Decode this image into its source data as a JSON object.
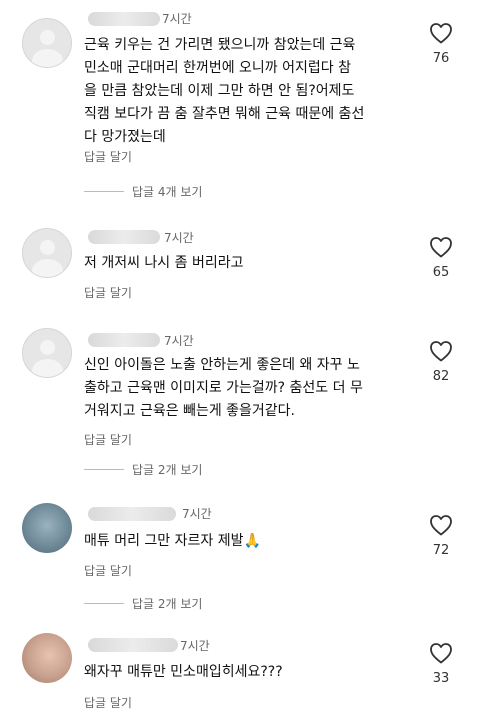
{
  "comments": [
    {
      "time": "7시간",
      "text": "근육 키우는 건 가리면 됐으니까 참았는데 근육\n민소매 군대머리 한꺼번에 오니까 어지럽다 참\n을 만큼 참았는데 이제 그만 하면 안 됨?어제도\n직캠 보다가 끔 춤 잘추면 뭐해 근육 때문에 춤선\n다 망가졌는데",
      "reply_label": "답글 달기",
      "view_replies_label": "답글 4개 보기",
      "likes": "76"
    },
    {
      "time": "7시간",
      "text": "저 개저씨 나시 좀 버리라고",
      "reply_label": "답글 달기",
      "likes": "65"
    },
    {
      "time": "7시간",
      "text": "신인 아이돌은 노출 안하는게 좋은데 왜 자꾸 노\n출하고 근육맨 이미지로 가는걸까? 춤선도 더 무\n거워지고 근육은 빼는게 좋을거같다.",
      "reply_label": "답글 달기",
      "view_replies_label": "답글 2개 보기",
      "likes": "82"
    },
    {
      "time": "7시간",
      "text": "매튜 머리 그만 자르자 제발🙏",
      "reply_label": "답글 달기",
      "view_replies_label": "답글 2개 보기",
      "likes": "72"
    },
    {
      "time": "7시간",
      "text": "왜자꾸 매튜만 민소매입히세요???",
      "reply_label": "답글 달기",
      "likes": "33"
    }
  ],
  "icons": {
    "like": "heart-outline-icon",
    "avatar": "default-avatar-icon"
  },
  "colors": {
    "secondary_text": "#666666",
    "primary_text": "#111111"
  }
}
